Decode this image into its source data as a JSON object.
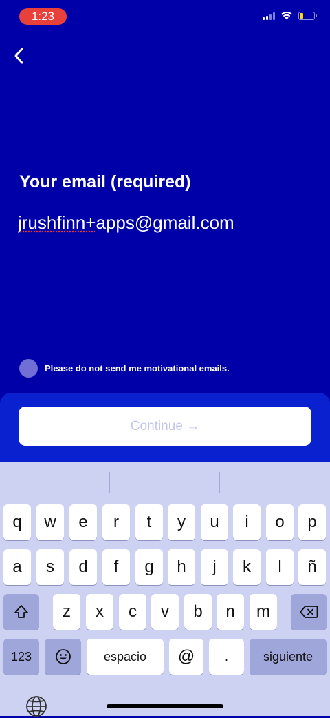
{
  "status_bar": {
    "time": "1:23",
    "accent": "#E8403A"
  },
  "form": {
    "email_label": "Your email (required)",
    "email_value": "jrushfinn+apps@gmail.com",
    "optout_label": "Please do not send me motivational emails.",
    "continue_label": "Continue →"
  },
  "keyboard": {
    "row1": [
      "q",
      "w",
      "e",
      "r",
      "t",
      "y",
      "u",
      "i",
      "o",
      "p"
    ],
    "row2": [
      "a",
      "s",
      "d",
      "f",
      "g",
      "h",
      "j",
      "k",
      "l",
      "ñ"
    ],
    "row3": [
      "z",
      "x",
      "c",
      "v",
      "b",
      "n",
      "m"
    ],
    "numbers_label": "123",
    "space_label": "espacio",
    "at_label": "@",
    "dot_label": ".",
    "return_label": "siguiente"
  },
  "colors": {
    "background": "#0000A8",
    "panel": "#0A21D0",
    "keyboard": "#CDD1F2"
  }
}
